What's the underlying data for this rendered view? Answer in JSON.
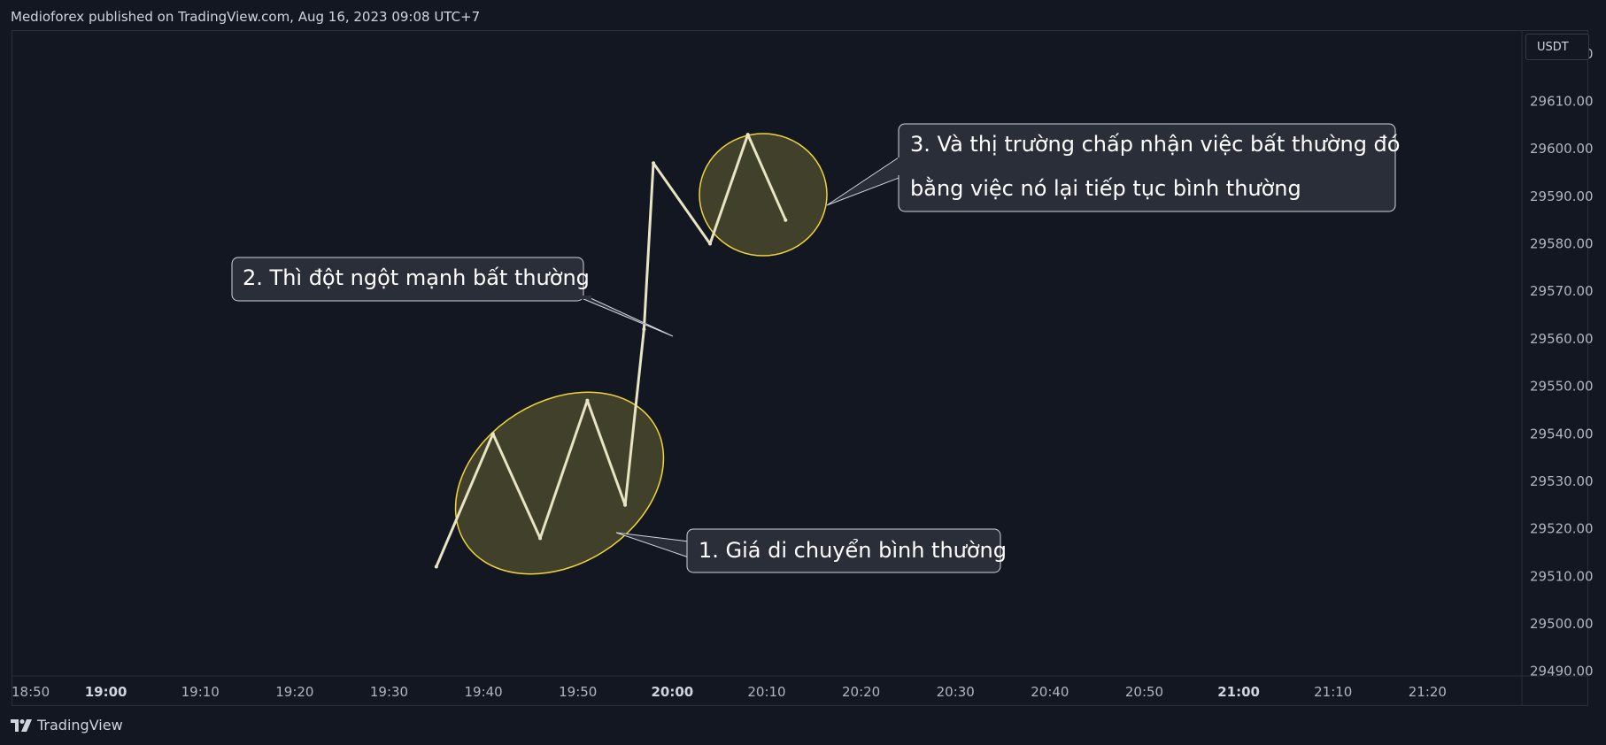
{
  "header": {
    "published_by": "Medioforex published on TradingView.com, Aug 16, 2023 09:08 UTC+7"
  },
  "footer": {
    "brand": "TradingView"
  },
  "currency": "USDT",
  "colors": {
    "background": "#131722",
    "price_line": "#e8e4c4",
    "ellipse_stroke": "#f0d53a",
    "ellipse_fill": "rgba(150,140,60,0.35)",
    "callout_bg": "#2a2e39",
    "callout_border": "#d1d4dc",
    "axis_text": "#b2b5be"
  },
  "chart_data": {
    "type": "line",
    "x": [
      "19:35",
      "19:41",
      "19:46",
      "19:51",
      "19:55",
      "19:57",
      "19:58",
      "20:04",
      "20:08",
      "20:12"
    ],
    "values": [
      29512,
      29540,
      29518,
      29547,
      29525,
      29562,
      29597,
      29580,
      29603,
      29585
    ],
    "xlim": [
      "18:50",
      "21:30"
    ],
    "ylim": [
      29489,
      29625
    ],
    "x_ticks": [
      {
        "label": "18:50",
        "bold": false
      },
      {
        "label": "19:00",
        "bold": true
      },
      {
        "label": "19:10",
        "bold": false
      },
      {
        "label": "19:20",
        "bold": false
      },
      {
        "label": "19:30",
        "bold": false
      },
      {
        "label": "19:40",
        "bold": false
      },
      {
        "label": "19:50",
        "bold": false
      },
      {
        "label": "20:00",
        "bold": true
      },
      {
        "label": "20:10",
        "bold": false
      },
      {
        "label": "20:20",
        "bold": false
      },
      {
        "label": "20:30",
        "bold": false
      },
      {
        "label": "20:40",
        "bold": false
      },
      {
        "label": "20:50",
        "bold": false
      },
      {
        "label": "21:00",
        "bold": true
      },
      {
        "label": "21:10",
        "bold": false
      },
      {
        "label": "21:20",
        "bold": false
      }
    ],
    "y_ticks": [
      "29490.00",
      "29500.00",
      "29510.00",
      "29520.00",
      "29530.00",
      "29540.00",
      "29550.00",
      "29560.00",
      "29570.00",
      "29580.00",
      "29590.00",
      "29600.00",
      "29610.00",
      "29620.00"
    ],
    "grid": false,
    "annotations": [
      {
        "id": "normal-move",
        "lines": [
          "1. Giá di chuyển bình thường"
        ]
      },
      {
        "id": "abnormal-spike",
        "lines": [
          "2. Thì đột ngột mạnh bất thường"
        ]
      },
      {
        "id": "market-accepts",
        "lines": [
          "3. Và thị trường chấp nhận việc bất thường đó",
          "bằng việc nó lại tiếp tục bình thường"
        ]
      }
    ]
  }
}
